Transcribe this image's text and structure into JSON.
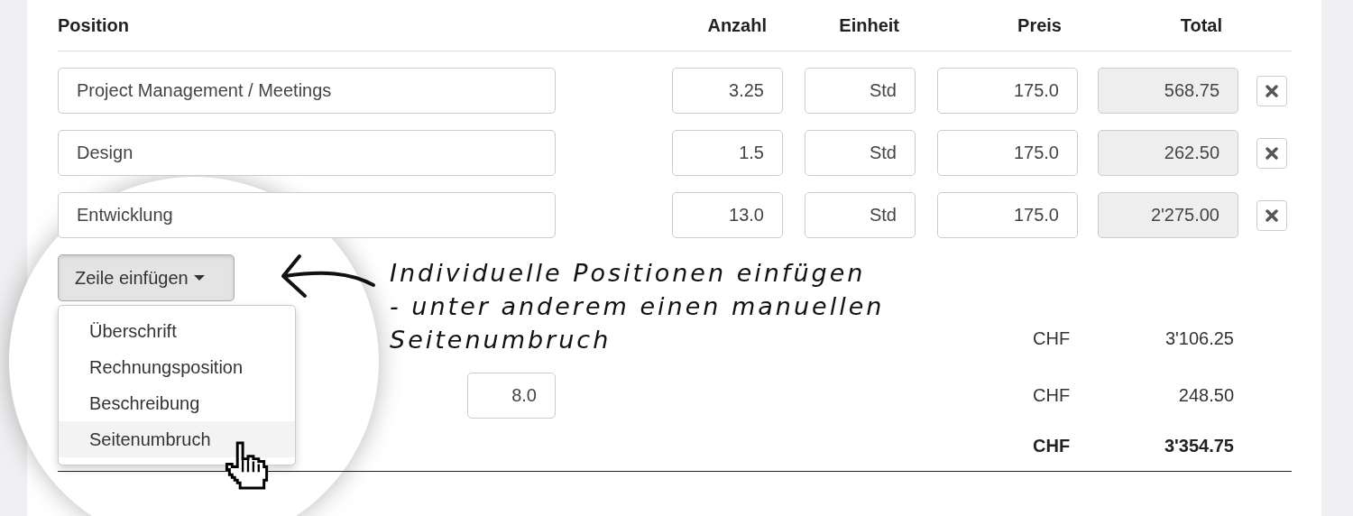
{
  "columns": [
    {
      "label": "Position"
    },
    {
      "label": "Anzahl"
    },
    {
      "label": "Einheit"
    },
    {
      "label": "Preis"
    },
    {
      "label": "Total"
    }
  ],
  "rows": [
    {
      "position": "Project Management / Meetings",
      "quantity": "3.25",
      "unit": "Std",
      "price": "175.0",
      "total": "568.75"
    },
    {
      "position": "Design",
      "quantity": "1.5",
      "unit": "Std",
      "price": "175.0",
      "total": "262.50"
    },
    {
      "position": "Entwicklung",
      "quantity": "13.0",
      "unit": "Std",
      "price": "175.0",
      "total": "2'275.00"
    }
  ],
  "insert_button": {
    "label": "Zeile einfügen",
    "expanded": true
  },
  "insert_menu": [
    {
      "label": "Überschrift",
      "selected": false
    },
    {
      "label": "Rechnungsposition",
      "selected": false
    },
    {
      "label": "Beschreibung",
      "selected": false
    },
    {
      "label": "Seitenumbruch",
      "selected": true
    }
  ],
  "totals": [
    {
      "kind": "subtotal",
      "currency": "CHF",
      "amount": "3'106.25"
    },
    {
      "kind": "tax",
      "field_value": "8.0",
      "currency": "CHF",
      "amount": "248.50"
    },
    {
      "kind": "grand",
      "currency": "CHF",
      "amount": "3'354.75"
    }
  ],
  "annotation": "Individuelle Positionen einfügen\n- unter anderem einen manuellen\nSeitenumbruch"
}
